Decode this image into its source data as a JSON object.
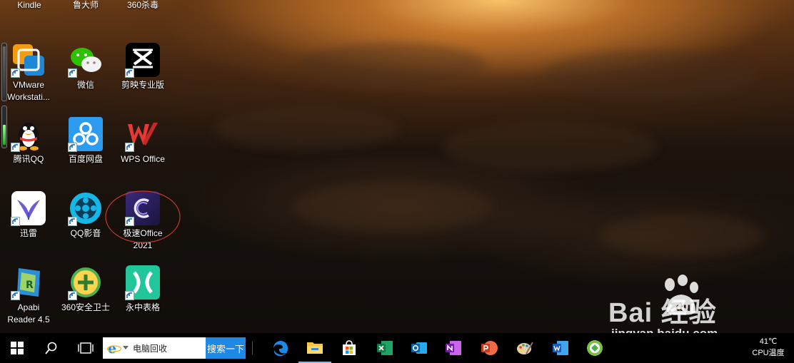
{
  "desktop": {
    "top_partial_labels": [
      "Kindle",
      "鲁大师",
      "360杀毒"
    ],
    "icons": [
      {
        "label": "VMware\nWorkstati...",
        "icon": "vmware-icon"
      },
      {
        "label": "微信",
        "icon": "wechat-icon"
      },
      {
        "label": "剪映专业版",
        "icon": "capcut-icon"
      },
      {
        "label": "腾讯QQ",
        "icon": "qq-icon"
      },
      {
        "label": "百度网盘",
        "icon": "baidu-netdisk-icon"
      },
      {
        "label": "WPS Office",
        "icon": "wps-icon"
      },
      {
        "label": "迅雷",
        "icon": "xunlei-icon"
      },
      {
        "label": "QQ影音",
        "icon": "qq-player-icon"
      },
      {
        "label": "极速Office\n2021",
        "icon": "jisu-office-icon"
      },
      {
        "label": "Apabi\nReader 4.5",
        "icon": "apabi-reader-icon"
      },
      {
        "label": "360安全卫士",
        "icon": "360-safe-icon"
      },
      {
        "label": "永中表格",
        "icon": "yozo-sheet-icon"
      }
    ]
  },
  "taskbar": {
    "search_query": "电脑回收",
    "search_button": "搜索一下",
    "apps": [
      "edge-icon",
      "file-explorer-icon",
      "store-icon",
      "excel-icon",
      "outlook-icon",
      "onenote-icon",
      "powerpoint-icon",
      "paint-icon",
      "word-icon",
      "360-browser-icon"
    ],
    "tray_temp": "41℃",
    "tray_label": "CPU温度"
  },
  "watermark": {
    "logo": "Bai 经验",
    "url": "jingyan.baidu.com"
  },
  "colors": {
    "taskbar": "#000000",
    "search_button": "#1e88e5",
    "annotation_circle": "#c0392b"
  }
}
